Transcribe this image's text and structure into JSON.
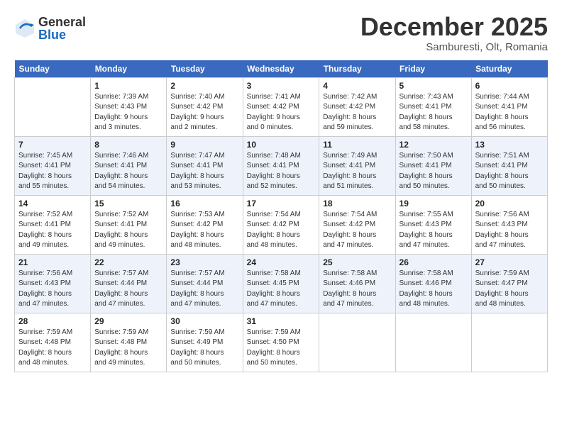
{
  "header": {
    "logo_general": "General",
    "logo_blue": "Blue",
    "month_title": "December 2025",
    "location": "Samburesti, Olt, Romania"
  },
  "weekdays": [
    "Sunday",
    "Monday",
    "Tuesday",
    "Wednesday",
    "Thursday",
    "Friday",
    "Saturday"
  ],
  "weeks": [
    [
      {
        "day": "",
        "info": ""
      },
      {
        "day": "1",
        "info": "Sunrise: 7:39 AM\nSunset: 4:43 PM\nDaylight: 9 hours\nand 3 minutes."
      },
      {
        "day": "2",
        "info": "Sunrise: 7:40 AM\nSunset: 4:42 PM\nDaylight: 9 hours\nand 2 minutes."
      },
      {
        "day": "3",
        "info": "Sunrise: 7:41 AM\nSunset: 4:42 PM\nDaylight: 9 hours\nand 0 minutes."
      },
      {
        "day": "4",
        "info": "Sunrise: 7:42 AM\nSunset: 4:42 PM\nDaylight: 8 hours\nand 59 minutes."
      },
      {
        "day": "5",
        "info": "Sunrise: 7:43 AM\nSunset: 4:41 PM\nDaylight: 8 hours\nand 58 minutes."
      },
      {
        "day": "6",
        "info": "Sunrise: 7:44 AM\nSunset: 4:41 PM\nDaylight: 8 hours\nand 56 minutes."
      }
    ],
    [
      {
        "day": "7",
        "info": "Sunrise: 7:45 AM\nSunset: 4:41 PM\nDaylight: 8 hours\nand 55 minutes."
      },
      {
        "day": "8",
        "info": "Sunrise: 7:46 AM\nSunset: 4:41 PM\nDaylight: 8 hours\nand 54 minutes."
      },
      {
        "day": "9",
        "info": "Sunrise: 7:47 AM\nSunset: 4:41 PM\nDaylight: 8 hours\nand 53 minutes."
      },
      {
        "day": "10",
        "info": "Sunrise: 7:48 AM\nSunset: 4:41 PM\nDaylight: 8 hours\nand 52 minutes."
      },
      {
        "day": "11",
        "info": "Sunrise: 7:49 AM\nSunset: 4:41 PM\nDaylight: 8 hours\nand 51 minutes."
      },
      {
        "day": "12",
        "info": "Sunrise: 7:50 AM\nSunset: 4:41 PM\nDaylight: 8 hours\nand 50 minutes."
      },
      {
        "day": "13",
        "info": "Sunrise: 7:51 AM\nSunset: 4:41 PM\nDaylight: 8 hours\nand 50 minutes."
      }
    ],
    [
      {
        "day": "14",
        "info": "Sunrise: 7:52 AM\nSunset: 4:41 PM\nDaylight: 8 hours\nand 49 minutes."
      },
      {
        "day": "15",
        "info": "Sunrise: 7:52 AM\nSunset: 4:41 PM\nDaylight: 8 hours\nand 49 minutes."
      },
      {
        "day": "16",
        "info": "Sunrise: 7:53 AM\nSunset: 4:42 PM\nDaylight: 8 hours\nand 48 minutes."
      },
      {
        "day": "17",
        "info": "Sunrise: 7:54 AM\nSunset: 4:42 PM\nDaylight: 8 hours\nand 48 minutes."
      },
      {
        "day": "18",
        "info": "Sunrise: 7:54 AM\nSunset: 4:42 PM\nDaylight: 8 hours\nand 47 minutes."
      },
      {
        "day": "19",
        "info": "Sunrise: 7:55 AM\nSunset: 4:43 PM\nDaylight: 8 hours\nand 47 minutes."
      },
      {
        "day": "20",
        "info": "Sunrise: 7:56 AM\nSunset: 4:43 PM\nDaylight: 8 hours\nand 47 minutes."
      }
    ],
    [
      {
        "day": "21",
        "info": "Sunrise: 7:56 AM\nSunset: 4:43 PM\nDaylight: 8 hours\nand 47 minutes."
      },
      {
        "day": "22",
        "info": "Sunrise: 7:57 AM\nSunset: 4:44 PM\nDaylight: 8 hours\nand 47 minutes."
      },
      {
        "day": "23",
        "info": "Sunrise: 7:57 AM\nSunset: 4:44 PM\nDaylight: 8 hours\nand 47 minutes."
      },
      {
        "day": "24",
        "info": "Sunrise: 7:58 AM\nSunset: 4:45 PM\nDaylight: 8 hours\nand 47 minutes."
      },
      {
        "day": "25",
        "info": "Sunrise: 7:58 AM\nSunset: 4:46 PM\nDaylight: 8 hours\nand 47 minutes."
      },
      {
        "day": "26",
        "info": "Sunrise: 7:58 AM\nSunset: 4:46 PM\nDaylight: 8 hours\nand 48 minutes."
      },
      {
        "day": "27",
        "info": "Sunrise: 7:59 AM\nSunset: 4:47 PM\nDaylight: 8 hours\nand 48 minutes."
      }
    ],
    [
      {
        "day": "28",
        "info": "Sunrise: 7:59 AM\nSunset: 4:48 PM\nDaylight: 8 hours\nand 48 minutes."
      },
      {
        "day": "29",
        "info": "Sunrise: 7:59 AM\nSunset: 4:48 PM\nDaylight: 8 hours\nand 49 minutes."
      },
      {
        "day": "30",
        "info": "Sunrise: 7:59 AM\nSunset: 4:49 PM\nDaylight: 8 hours\nand 50 minutes."
      },
      {
        "day": "31",
        "info": "Sunrise: 7:59 AM\nSunset: 4:50 PM\nDaylight: 8 hours\nand 50 minutes."
      },
      {
        "day": "",
        "info": ""
      },
      {
        "day": "",
        "info": ""
      },
      {
        "day": "",
        "info": ""
      }
    ]
  ]
}
